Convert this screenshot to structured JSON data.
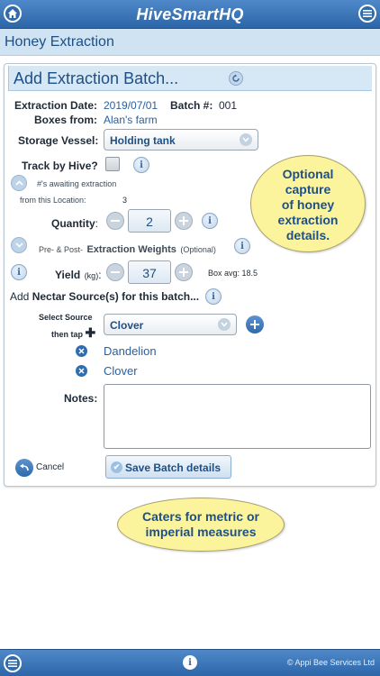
{
  "app": {
    "title": "HiveSmartHQ"
  },
  "page": {
    "title": "Honey Extraction"
  },
  "form": {
    "title": "Add Extraction Batch...",
    "extraction_date_label": "Extraction Date:",
    "extraction_date_value": "2019/07/01",
    "batch_label": "Batch #:",
    "batch_value": "001",
    "boxes_from_label": "Boxes from:",
    "boxes_from_value": "Alan's farm",
    "storage_vessel_label": "Storage Vessel:",
    "storage_vessel_value": "Holding tank",
    "track_by_hive_label": "Track by Hive?",
    "awaiting_label": "#'s awaiting extraction",
    "from_location_label": "from this Location:",
    "from_location_value": "3",
    "quantity_label": "Quantity",
    "quantity_value": "2",
    "weights_prefix": "Pre- & Post-",
    "weights_title": "Extraction Weights",
    "weights_suffix": "(Optional)",
    "yield_label": "Yield",
    "yield_unit": "(kg)",
    "yield_value": "37",
    "box_avg_label": "Box avg: 18.5",
    "nectar_prefix": "Add",
    "nectar_title": "Nectar Source(s) for this batch...",
    "select_source_line1": "Select Source",
    "select_source_line2": "then tap",
    "select_source_value": "Clover",
    "sources": [
      "Dandelion",
      "Clover"
    ],
    "notes_label": "Notes:",
    "notes_value": "",
    "cancel_label": "Cancel",
    "save_label": "Save Batch details"
  },
  "bubbles": {
    "optional": [
      "Optional",
      "capture",
      "of honey",
      "extraction",
      "details."
    ],
    "measures": [
      "Caters for metric or",
      "imperial measures"
    ]
  },
  "footer": {
    "copyright": "© Appi Bee Services Ltd"
  },
  "colors": {
    "header_blue": "#2c66a8",
    "sub_header": "#cfe3f2",
    "link_blue": "#2a5f9e",
    "bubble_yellow": "#fbf49c"
  },
  "icons": [
    "home-icon",
    "menu-icon",
    "refresh-icon",
    "info-icon",
    "chevron-up-icon",
    "chevron-down-icon",
    "plus-icon",
    "minus-icon",
    "remove-icon",
    "check-icon",
    "back-arrow-icon"
  ]
}
